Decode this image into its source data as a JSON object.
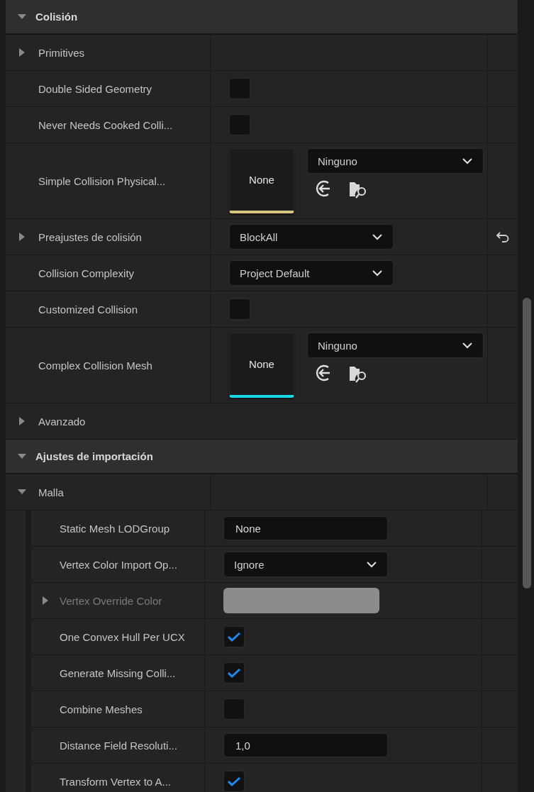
{
  "sections": [
    {
      "title": "Colisión",
      "expanded": true,
      "rows": [
        {
          "kind": "group",
          "label": "Primitives",
          "expanded": false
        },
        {
          "kind": "checkbox",
          "label": "Double Sided Geometry",
          "checked": false
        },
        {
          "kind": "checkbox",
          "label": "Never Needs Cooked Colli...",
          "checked": false
        },
        {
          "kind": "asset",
          "label": "Simple Collision Physical...",
          "thumbnail": "None",
          "value": "Ninguno",
          "color": "#d6c57e"
        },
        {
          "kind": "dropdown",
          "label": "Preajustes de colisión",
          "value": "BlockAll",
          "expanded": false,
          "resettable": true
        },
        {
          "kind": "dropdown",
          "label": "Collision Complexity",
          "value": "Project Default"
        },
        {
          "kind": "checkbox",
          "label": "Customized Collision",
          "checked": false
        },
        {
          "kind": "asset",
          "label": "Complex Collision Mesh",
          "thumbnail": "None",
          "value": "Ninguno",
          "color": "#14d8e6"
        },
        {
          "kind": "category",
          "label": "Avanzado",
          "expanded": false
        }
      ]
    },
    {
      "title": "Ajustes de importación",
      "expanded": true,
      "rows": [
        {
          "kind": "group",
          "label": "Malla",
          "expanded": true,
          "children": [
            {
              "kind": "text",
              "label": "Static Mesh LODGroup",
              "value": "None"
            },
            {
              "kind": "dropdown",
              "label": "Vertex Color Import Op...",
              "value": "Ignore"
            },
            {
              "kind": "color",
              "label": "Vertex Override Color",
              "expanded": false,
              "disabled": true,
              "color": "#8c8c8c"
            },
            {
              "kind": "checkbox",
              "label": "One Convex Hull Per UCX",
              "checked": true
            },
            {
              "kind": "checkbox",
              "label": "Generate Missing Colli...",
              "checked": true
            },
            {
              "kind": "checkbox",
              "label": "Combine Meshes",
              "checked": false
            },
            {
              "kind": "text",
              "label": "Distance Field Resoluti...",
              "value": "1,0"
            },
            {
              "kind": "checkbox",
              "label": "Transform Vertex to A...",
              "checked": true
            }
          ]
        }
      ]
    }
  ]
}
